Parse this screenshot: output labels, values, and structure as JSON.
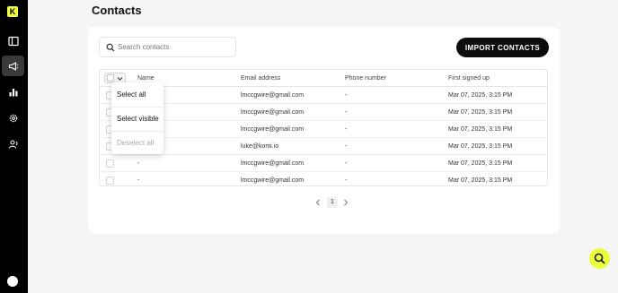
{
  "app": {
    "logo_letter": "K"
  },
  "sidebar": {
    "items": [
      {
        "icon": "layout-icon"
      },
      {
        "icon": "megaphone-icon",
        "active": true
      },
      {
        "icon": "bar-chart-icon"
      },
      {
        "icon": "gear-icon"
      },
      {
        "icon": "users-icon"
      }
    ],
    "profile_icon": "avatar"
  },
  "page": {
    "title": "Contacts"
  },
  "search": {
    "placeholder": "Search contacts",
    "value": ""
  },
  "toolbar": {
    "import_label": "IMPORT CONTACTS"
  },
  "table": {
    "columns": [
      "Name",
      "Email address",
      "Phone number",
      "First signed up"
    ],
    "rows": [
      {
        "name": "",
        "email": "lmccgwire@gmail.com",
        "phone": "-",
        "signed_up": "Mar 07, 2025, 3:15 PM"
      },
      {
        "name": "",
        "email": "lmccgwire@gmail.com",
        "phone": "-",
        "signed_up": "Mar 07, 2025, 3:15 PM"
      },
      {
        "name": "",
        "email": "lmccgwire@gmail.com",
        "phone": "-",
        "signed_up": "Mar 07, 2025, 3:15 PM"
      },
      {
        "name": "",
        "email": "luke@komi.io",
        "phone": "-",
        "signed_up": "Mar 07, 2025, 3:15 PM"
      },
      {
        "name": "-",
        "email": "lmccgwire@gmail.com",
        "phone": "-",
        "signed_up": "Mar 07, 2025, 3:15 PM"
      },
      {
        "name": "-",
        "email": "lmccgwire@gmail.com",
        "phone": "-",
        "signed_up": "Mar 07, 2025, 3:15 PM"
      }
    ]
  },
  "select_menu": {
    "items": [
      {
        "label": "Select all",
        "disabled": false
      },
      {
        "label": "Select visible",
        "disabled": false
      },
      {
        "label": "Deselect all",
        "disabled": true
      }
    ]
  },
  "pagination": {
    "current_page": "1"
  },
  "colors": {
    "accent": "#eaff3a",
    "sidebar": "#000000",
    "button": "#0d0d0d"
  }
}
